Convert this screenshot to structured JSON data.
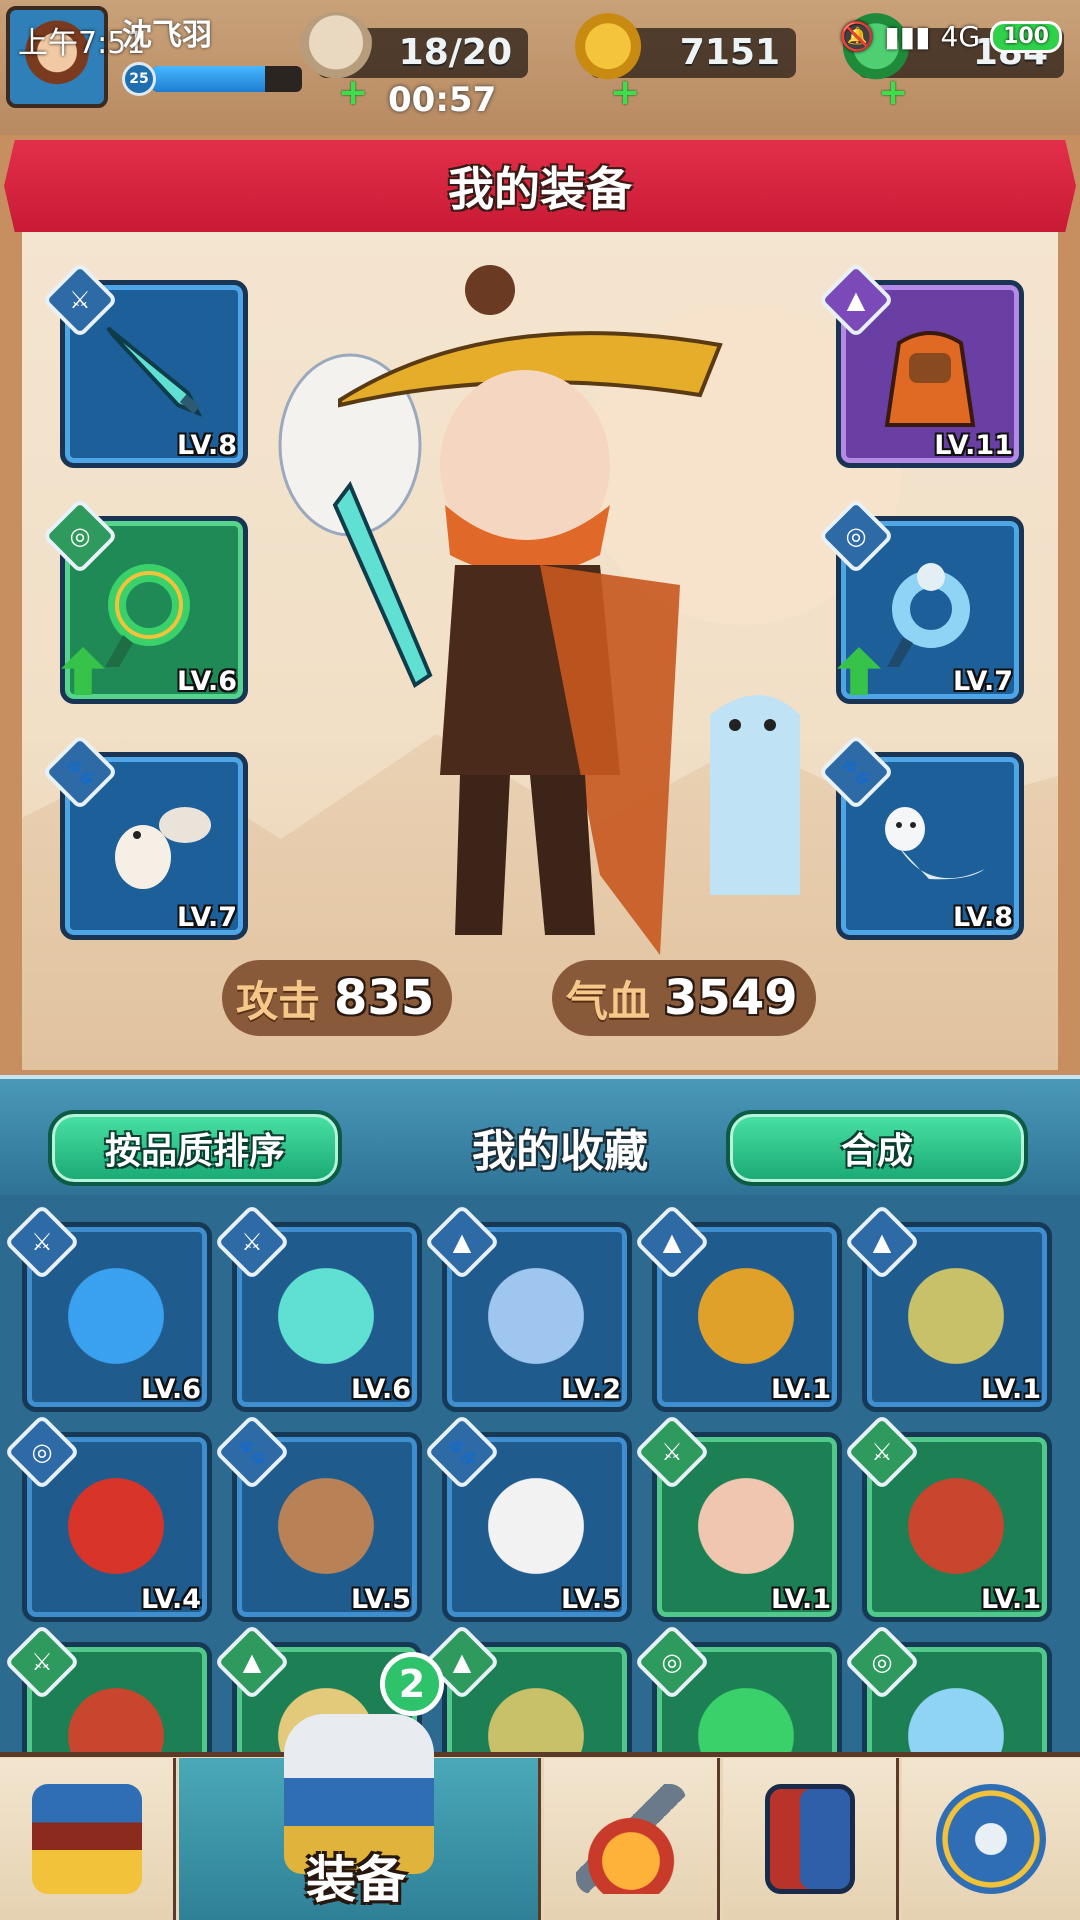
{
  "status_bar": {
    "time": "上午7:51",
    "network": "4G",
    "battery": "100"
  },
  "player": {
    "name": "沈飞羽",
    "level": "25",
    "xp_fraction": 0.75
  },
  "resources": [
    {
      "name": "stamina",
      "icon": "bun-icon",
      "value": "18/20"
    },
    {
      "name": "gold",
      "icon": "gold-leaf-icon",
      "value": "7151"
    },
    {
      "name": "jade",
      "icon": "jade-leaf-icon",
      "value": "184"
    }
  ],
  "stamina_timer": "00:57",
  "equipment_panel": {
    "title": "我的装备",
    "slots": [
      {
        "side": "left",
        "type": "weapon",
        "type_icon": "sword-type-icon",
        "item_icon": "jade-dagger-icon",
        "level": "LV.8",
        "rarity": "blue",
        "upgradable": false
      },
      {
        "side": "left",
        "type": "accessory",
        "type_icon": "ring-type-icon",
        "item_icon": "jade-pendant-icon",
        "level": "LV.6",
        "rarity": "green",
        "upgradable": true
      },
      {
        "side": "left",
        "type": "pet",
        "type_icon": "paw-type-icon",
        "item_icon": "white-squirrel-icon",
        "level": "LV.7",
        "rarity": "blue",
        "upgradable": false
      },
      {
        "side": "right",
        "type": "armor",
        "type_icon": "armor-type-icon",
        "item_icon": "orange-cape-icon",
        "level": "LV.11",
        "rarity": "purple",
        "upgradable": false
      },
      {
        "side": "right",
        "type": "accessory",
        "type_icon": "ring-type-icon",
        "item_icon": "blue-pendant-icon",
        "level": "LV.7",
        "rarity": "blue",
        "upgradable": true
      },
      {
        "side": "right",
        "type": "pet",
        "type_icon": "paw-type-icon",
        "item_icon": "white-ferret-icon",
        "level": "LV.8",
        "rarity": "blue",
        "upgradable": false
      }
    ],
    "stats": [
      {
        "label": "攻击",
        "value": "835"
      },
      {
        "label": "气血",
        "value": "3549"
      }
    ]
  },
  "collection": {
    "title": "我的收藏",
    "sort_button": "按品质排序",
    "merge_button": "合成",
    "items": [
      {
        "type": "weapon",
        "type_icon": "sword-type-icon",
        "item_icon": "blue-fan-icon",
        "level": "LV.6",
        "rarity": "blue"
      },
      {
        "type": "weapon",
        "type_icon": "sword-type-icon",
        "item_icon": "jade-dagger-icon",
        "level": "LV.6",
        "rarity": "blue"
      },
      {
        "type": "armor",
        "type_icon": "armor-type-icon",
        "item_icon": "snow-cloak-icon",
        "level": "LV.2",
        "rarity": "blue"
      },
      {
        "type": "armor",
        "type_icon": "armor-type-icon",
        "item_icon": "gold-armor-icon",
        "level": "LV.1",
        "rarity": "blue"
      },
      {
        "type": "armor",
        "type_icon": "armor-type-icon",
        "item_icon": "green-robe-icon",
        "level": "LV.1",
        "rarity": "blue"
      },
      {
        "type": "accessory",
        "type_icon": "ring-type-icon",
        "item_icon": "red-pendant-icon",
        "level": "LV.4",
        "rarity": "blue"
      },
      {
        "type": "pet",
        "type_icon": "paw-type-icon",
        "item_icon": "monkey-icon",
        "level": "LV.5",
        "rarity": "blue"
      },
      {
        "type": "pet",
        "type_icon": "paw-type-icon",
        "item_icon": "panda-icon",
        "level": "LV.5",
        "rarity": "blue"
      },
      {
        "type": "weapon",
        "type_icon": "sword-type-icon",
        "item_icon": "landscape-fan-icon",
        "level": "LV.1",
        "rarity": "green"
      },
      {
        "type": "weapon",
        "type_icon": "sword-type-icon",
        "item_icon": "crossbow-icon",
        "level": "LV.1",
        "rarity": "green"
      },
      {
        "type": "weapon",
        "type_icon": "sword-type-icon",
        "item_icon": "crossbow-icon",
        "level": "",
        "rarity": "green"
      },
      {
        "type": "armor",
        "type_icon": "armor-type-icon",
        "item_icon": "armor-icon",
        "level": "",
        "rarity": "green"
      },
      {
        "type": "armor",
        "type_icon": "armor-type-icon",
        "item_icon": "green-robe-icon",
        "level": "",
        "rarity": "green"
      },
      {
        "type": "accessory",
        "type_icon": "ring-type-icon",
        "item_icon": "jade-pendant-icon",
        "level": "",
        "rarity": "green"
      },
      {
        "type": "accessory",
        "type_icon": "ring-type-icon",
        "item_icon": "blue-pendant-icon",
        "level": "",
        "rarity": "green"
      }
    ]
  },
  "bottom_nav": {
    "items": [
      {
        "id": "shop",
        "icon": "shop-icon",
        "label": ""
      },
      {
        "id": "equipment",
        "icon": "armor-icon",
        "label": "装备",
        "badge": "2",
        "active": true
      },
      {
        "id": "forge",
        "icon": "forge-icon",
        "label": ""
      },
      {
        "id": "book",
        "icon": "book-icon",
        "label": ""
      },
      {
        "id": "settings",
        "icon": "gear-icon",
        "label": ""
      }
    ]
  },
  "colors": {
    "banner_red": "#d8233f",
    "panel_cream": "#f3e2cb",
    "slot_blue": "#1d5f99",
    "slot_green": "#1f8a55",
    "slot_purple": "#6a3fa4",
    "button_green": "#2fcf8a",
    "collection_teal": "#2e7396"
  }
}
